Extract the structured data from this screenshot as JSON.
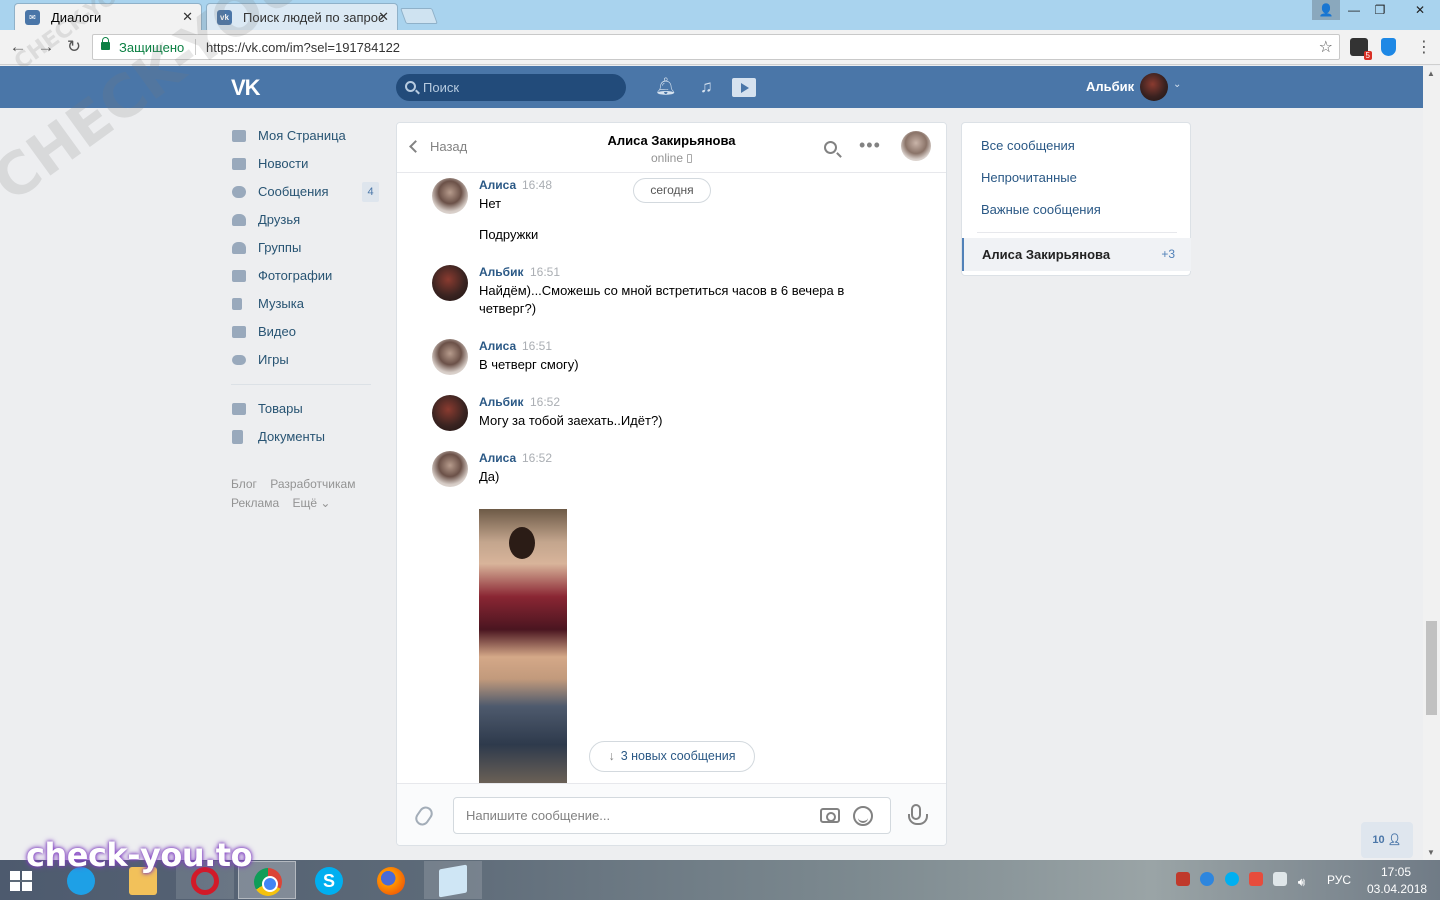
{
  "browser": {
    "tabs": [
      {
        "title": "Диалоги",
        "active": true
      },
      {
        "title": "Поиск людей по запрос",
        "active": false
      }
    ],
    "secure_label": "Защищено",
    "url": "https://vk.com/im?sel=191784122",
    "extension_badge": "5"
  },
  "vk_header": {
    "logo": "VK",
    "search_placeholder": "Поиск",
    "user_name": "Альбик",
    "brand_color": "#4a76a8"
  },
  "left_menu": {
    "items": [
      {
        "label": "Моя Страница",
        "icon": "home-icon"
      },
      {
        "label": "Новости",
        "icon": "news-icon"
      },
      {
        "label": "Сообщения",
        "icon": "messages-icon",
        "count": "4"
      },
      {
        "label": "Друзья",
        "icon": "friends-icon"
      },
      {
        "label": "Группы",
        "icon": "groups-icon"
      },
      {
        "label": "Фотографии",
        "icon": "camera-icon"
      },
      {
        "label": "Музыка",
        "icon": "music-icon"
      },
      {
        "label": "Видео",
        "icon": "video-icon"
      },
      {
        "label": "Игры",
        "icon": "games-icon"
      }
    ],
    "items2": [
      {
        "label": "Товары",
        "icon": "bag-icon"
      },
      {
        "label": "Документы",
        "icon": "document-icon"
      }
    ],
    "footer": [
      "Блог",
      "Разработчикам",
      "Реклама",
      "Ещё ⌄"
    ]
  },
  "chat": {
    "back_label": "Назад",
    "peer_name": "Алиса Закирьянова",
    "peer_status": "online",
    "date_divider": "сегодня",
    "messages": [
      {
        "author": "Алиса",
        "time": "16:48",
        "lines": [
          "Нет",
          "Подружки"
        ]
      },
      {
        "author": "Альбик",
        "time": "16:51",
        "lines": [
          "Найдём)...Сможешь со мной встретиться часов в 6 вечера в четверг?)"
        ]
      },
      {
        "author": "Алиса",
        "time": "16:51",
        "lines": [
          "В четверг смогу)"
        ]
      },
      {
        "author": "Альбик",
        "time": "16:52",
        "lines": [
          "Могу за тобой заехать..Идёт?)"
        ]
      },
      {
        "author": "Алиса",
        "time": "16:52",
        "lines": [
          "Да)"
        ]
      }
    ],
    "new_messages_label": "3 новых сообщения",
    "input_placeholder": "Напишите сообщение..."
  },
  "folders": {
    "items": [
      "Все сообщения",
      "Непрочитанные",
      "Важные сообщения"
    ],
    "active_dialog": {
      "name": "Алиса Закирьянова",
      "count": "+3"
    }
  },
  "online_counter": "10",
  "taskbar": {
    "apps": [
      "windows-start",
      "internet-explorer",
      "file-explorer",
      "opera",
      "chrome",
      "skype",
      "firefox",
      "notepad"
    ],
    "language": "РУС",
    "time": "17:05",
    "date": "03.04.2018"
  },
  "watermarks": {
    "big": "CHECK-YOU.ME",
    "small": "CHECK-YOU.ME",
    "logo": "check-you.to"
  }
}
